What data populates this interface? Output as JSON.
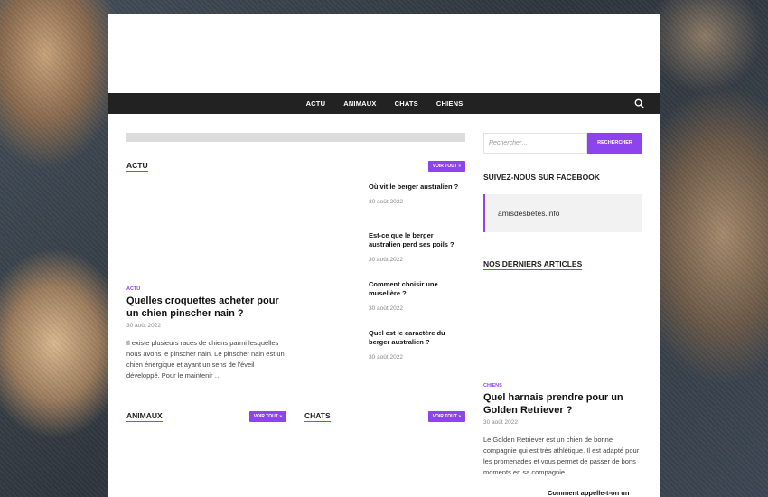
{
  "nav": {
    "items": [
      "ACTU",
      "ANIMAUX",
      "CHATS",
      "CHIENS"
    ]
  },
  "actu": {
    "title": "ACTU",
    "voir": "VOIR TOUT »",
    "featured": {
      "tag": "ACTU",
      "title": "Quelles croquettes acheter pour un chien pinscher nain ?",
      "date": "30 août 2022",
      "excerpt": "Il existe plusieurs races de chiens parmi lesquelles nous avons le pinscher nain. Le pinscher nain est un chien énergique et ayant un sens de l'éveil développé. Pour le maintenir …"
    },
    "list": [
      {
        "title": "Où vit le berger australien ?",
        "date": "30 août 2022"
      },
      {
        "title": "Est-ce que le berger australien perd ses poils ?",
        "date": "30 août 2022"
      },
      {
        "title": "Comment choisir une muselière ?",
        "date": "30 août 2022"
      },
      {
        "title": "Quel est le caractère du berger australien ?",
        "date": "30 août 2022"
      }
    ]
  },
  "animaux": {
    "title": "ANIMAUX",
    "voir": "VOIR TOUT »"
  },
  "chats": {
    "title": "CHATS",
    "voir": "VOIR TOUT »"
  },
  "sidebar": {
    "search_placeholder": "Rechercher…",
    "search_button": "RECHERCHER",
    "facebook_title": "SUIVEZ-NOUS SUR FACEBOOK",
    "facebook_link": "amisdesbetes.info",
    "latest_title": "NOS DERNIERS ARTICLES",
    "latest": {
      "tag": "CHIENS",
      "title": "Quel harnais prendre pour un Golden Retriever ?",
      "date": "30 août 2022",
      "excerpt": "Le Golden Retriever est un chien de bonne compagnie qui est très athlétique. Il est adapté pour les promenades et vous permet de passer de bons moments en sa compagnie. …"
    },
    "next_title": "Comment appelle-t-on un"
  },
  "colors": {
    "accent": "#8e44ec",
    "nav_bg": "#222222"
  }
}
